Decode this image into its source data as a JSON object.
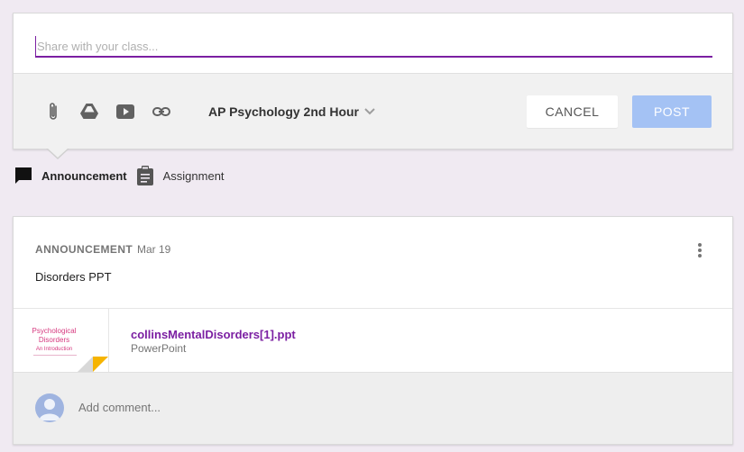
{
  "composer": {
    "placeholder": "Share with your class...",
    "class_name": "AP Psychology 2nd Hour",
    "cancel_label": "CANCEL",
    "post_label": "POST",
    "tools": [
      "paperclip-icon",
      "google-drive-icon",
      "youtube-icon",
      "link-icon"
    ]
  },
  "post_types": {
    "announcement_label": "Announcement",
    "assignment_label": "Assignment",
    "selected": "Announcement"
  },
  "stream_post": {
    "kind": "ANNOUNCEMENT",
    "date": "Mar 19",
    "body": "Disorders PPT",
    "attachment": {
      "title": "collinsMentalDisorders[1].ppt",
      "type": "PowerPoint",
      "thumb_title_line1": "Psychological",
      "thumb_title_line2": "Disorders",
      "thumb_subtitle": "An Introduction"
    },
    "comment_placeholder": "Add comment..."
  },
  "colors": {
    "accent": "#7b1fa2",
    "post_button": "#a4c2f4",
    "background": "#f0eaf2"
  }
}
